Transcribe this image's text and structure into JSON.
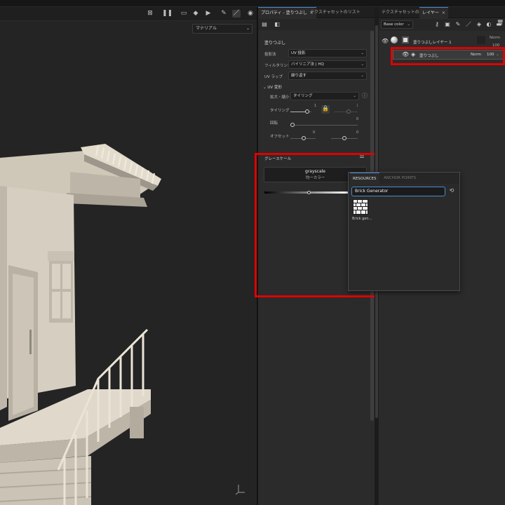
{
  "viewport": {
    "material_select": "マテリアル",
    "tool_icons": [
      "scene-icon",
      "pause-icon",
      "select-icon",
      "cube-icon",
      "camera-icon",
      "brush-icon",
      "paint-brush-icon",
      "snapshot-icon"
    ]
  },
  "props_panel": {
    "tabs": [
      {
        "label": "プロパティ - 塗りつぶし",
        "close": "×"
      },
      {
        "label": "テクスチャセットのリスト"
      }
    ],
    "section_title": "塗りつぶし",
    "projection_label": "投影法",
    "projection_value": "UV 投影",
    "filtering_label": "フィルタリング",
    "filtering_value": "バイリニア法 | HQ",
    "uvwrap_label": "UV ラップ",
    "uvwrap_value": "繰り返す",
    "uv_transform_title": "UV 変形",
    "scale_label": "拡大・縮小",
    "scale_value": "タイリング",
    "tiling_label": "タイリング",
    "tiling_value": "1",
    "tiling_value2": "1",
    "rotation_label": "回転",
    "rotation_value": "0",
    "offset_label": "オフセット",
    "offset_value": "0",
    "offset_value2": "0",
    "grayscale_label": "グレースケール",
    "grayscale_slot_title": "grayscale",
    "grayscale_slot_sub": "均一カラー"
  },
  "resource_popup": {
    "tabs": [
      "RESOURCES",
      "ANCHOR POINTS"
    ],
    "search_value": "Brick Generator",
    "result_label": "Brick gen..."
  },
  "layers_panel": {
    "tabs": [
      {
        "label": "テクスチャセットの設定"
      },
      {
        "label": "レイヤー",
        "close": "×"
      }
    ],
    "channel_select": "Base color",
    "layers": [
      {
        "name": "塗りつぶしレイヤー 1",
        "blend": "Norm",
        "opacity": "100"
      },
      {
        "name": "塗りつぶし",
        "blend": "Norm",
        "opacity": "100"
      }
    ]
  },
  "colors": {
    "accent": "#4a8ad6",
    "highlight": "#e00000",
    "building": "#d6cfc1"
  }
}
